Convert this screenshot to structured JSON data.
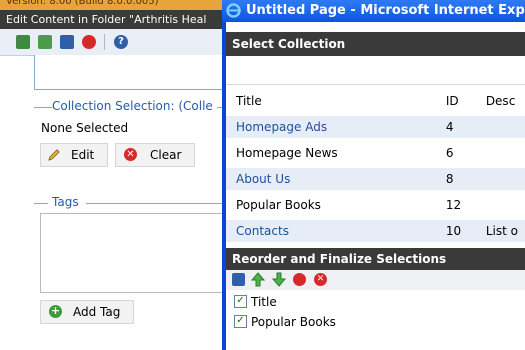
{
  "cms": {
    "version_text": "Version: 8.00 (Build 8.0.0.005)",
    "edit_header": "Edit Content in Folder \"Arthritis Heal",
    "collection_legend": "Collection Selection:   (Colle",
    "none_selected": "None Selected",
    "edit_label": "Edit",
    "clear_label": "Clear",
    "tags_legend": "Tags",
    "add_tag_label": "Add Tag"
  },
  "popup": {
    "window_title": "Untitled Page - Microsoft Internet Explorer p",
    "select_header": "Select Collection",
    "columns": {
      "title": "Title",
      "id": "ID",
      "desc": "Desc"
    },
    "rows": [
      {
        "title": "Homepage Ads",
        "id": "4",
        "desc": ""
      },
      {
        "title": "Homepage News",
        "id": "6",
        "desc": ""
      },
      {
        "title": "About Us",
        "id": "8",
        "desc": ""
      },
      {
        "title": "Popular Books",
        "id": "12",
        "desc": ""
      },
      {
        "title": "Contacts",
        "id": "10",
        "desc": "List o"
      }
    ],
    "reorder_header": "Reorder and Finalize Selections",
    "selections": [
      {
        "label": "Title"
      },
      {
        "label": "Popular Books"
      }
    ]
  },
  "colors": {
    "header_dark": "#3a3a3a",
    "link_blue": "#1d4f9a",
    "legend_blue": "#2b5aa8",
    "row_alt": "#e6edf6",
    "ie_blue": "#0a55e0"
  }
}
